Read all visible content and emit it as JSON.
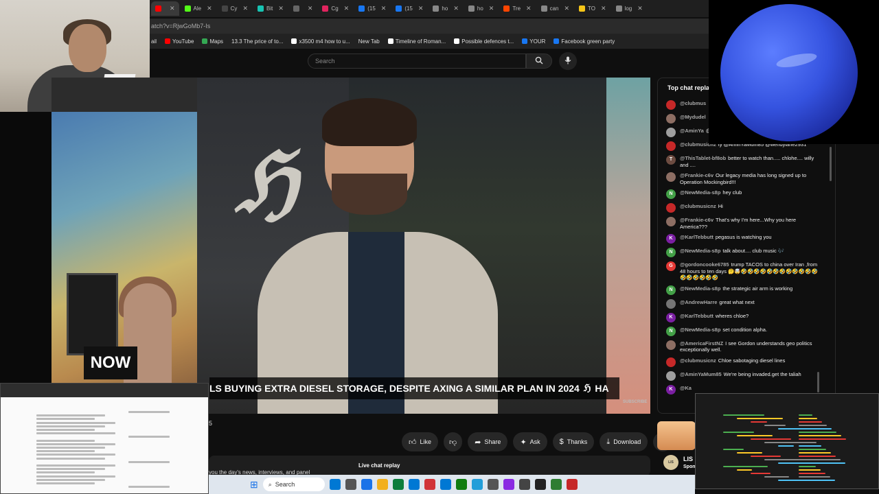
{
  "browser": {
    "tabs": [
      {
        "label": "",
        "color": "#ff0000",
        "active": true
      },
      {
        "label": "Ale",
        "color": "#53fc18"
      },
      {
        "label": "Cy",
        "color": "#444444"
      },
      {
        "label": "Bit",
        "color": "#17c3b2"
      },
      {
        "label": "",
        "color": "#666666"
      },
      {
        "label": "Cg",
        "color": "#e0245e"
      },
      {
        "label": "(15",
        "color": "#1877f2"
      },
      {
        "label": "(15",
        "color": "#1877f2"
      },
      {
        "label": "ho",
        "color": "#888888"
      },
      {
        "label": "ho",
        "color": "#888888"
      },
      {
        "label": "Tre",
        "color": "#ff4500"
      },
      {
        "label": "can",
        "color": "#888888"
      },
      {
        "label": "TO",
        "color": "#f5c518"
      },
      {
        "label": "log",
        "color": "#888888"
      }
    ],
    "address": "atch?v=RjwGoMb7-Is",
    "bookmarks": [
      {
        "label": "ail",
        "color": ""
      },
      {
        "label": "YouTube",
        "color": "#ff0000"
      },
      {
        "label": "Maps",
        "color": "#34a853"
      },
      {
        "label": "13.3 The price of to...",
        "color": ""
      },
      {
        "label": "x3500 m4 how to u...",
        "color": "#ffffff"
      },
      {
        "label": "New Tab",
        "color": ""
      },
      {
        "label": "Timeline of Roman...",
        "color": "#ffffff"
      },
      {
        "label": "Possible defences t...",
        "color": "#ffffff"
      },
      {
        "label": "YOUR",
        "color": "#1877f2"
      },
      {
        "label": "Facebook green party",
        "color": "#1877f2"
      }
    ]
  },
  "youtube": {
    "search_placeholder": "Search",
    "search_icon": "search-icon",
    "mic_icon": "mic-icon"
  },
  "video": {
    "badge": "NOW",
    "ticker": "LS BUYING EXTRA DIESEL STORAGE, DESPITE AXING A SIMILAR PLAN IN 2024",
    "ticker_logo": "ℌ",
    "ticker_tail": "HA",
    "subscribe": "SUBSCRIBE",
    "channel_logo": "ℌ"
  },
  "actions": {
    "like": "Like",
    "share": "Share",
    "ask": "Ask",
    "thanks": "Thanks",
    "download": "Download",
    "more": "⋯"
  },
  "description": {
    "text": "you the day's news, interviews, and panel",
    "live_replay": "Live chat replay",
    "count": "5"
  },
  "chat": {
    "title": "Top chat repla",
    "messages": [
      {
        "author": "@clubmus",
        "text": "",
        "initial": "",
        "color": "#c62828"
      },
      {
        "author": "@Mydudel",
        "text": "",
        "initial": "",
        "color": "#8d6e63"
      },
      {
        "author": "@AminYa",
        "text": "@gordy",
        "initial": "",
        "color": "#9e9e9e"
      },
      {
        "author": "@clubmusicnz",
        "text": "ty @AminYaMum85 @wendylane2931",
        "initial": "",
        "color": "#c62828"
      },
      {
        "author": "@ThisTablet-bf8ob",
        "text": "better to watch than..... chlohe.... willy and ....",
        "initial": "T",
        "color": "#6d4c41"
      },
      {
        "author": "@Frankie-c6v",
        "text": "Our legacy media has long signed up to Operation Mockingbird!!!",
        "initial": "",
        "color": "#8d6e63"
      },
      {
        "author": "@NewMedia-s8p",
        "text": "hey club",
        "initial": "N",
        "color": "#43a047"
      },
      {
        "author": "@clubmusicnz",
        "text": "Hi",
        "initial": "",
        "color": "#c62828"
      },
      {
        "author": "@Frankie-c6v",
        "text": "That's why I'm here...Why you here America???",
        "initial": "",
        "color": "#8d6e63"
      },
      {
        "author": "@KarlTebbutt",
        "text": "pegasus is watching you",
        "initial": "K",
        "color": "#7b1fa2"
      },
      {
        "author": "@NewMedia-s8p",
        "text": "talk about.... club music 🎶",
        "initial": "N",
        "color": "#43a047"
      },
      {
        "author": "@gordoncooke6785",
        "text": "trump TACOS to china over Iran ,from 48 hours to ten days 🤔🤯🤣🤣🤣🤣🤣🤣🤣🤣🤣🤣🤣🤣🤣🤣🤣🤣🤣🤣",
        "initial": "G",
        "color": "#e53935"
      },
      {
        "author": "@NewMedia-s8p",
        "text": "the strategic air arm is working",
        "initial": "N",
        "color": "#43a047"
      },
      {
        "author": "@AndrewHarre",
        "text": "great what next",
        "initial": "",
        "color": "#757575"
      },
      {
        "author": "@KarlTebbutt",
        "text": "wheres chloe?",
        "initial": "K",
        "color": "#7b1fa2"
      },
      {
        "author": "@NewMedia-s8p",
        "text": "set condition alpha.",
        "initial": "N",
        "color": "#43a047"
      },
      {
        "author": "@AmericaFirstNZ",
        "text": "I see Gordon understands geo politics exceptionally well.",
        "initial": "",
        "color": "#8d6e63"
      },
      {
        "author": "@clubmusicnz",
        "text": "Chloe sabotaging diesel lines",
        "initial": "",
        "color": "#c62828"
      },
      {
        "author": "@AminYaMum85",
        "text": "We're being invaded.get the taliah",
        "initial": "",
        "color": "#9e9e9e"
      },
      {
        "author": "@Ka",
        "text": "",
        "initial": "K",
        "color": "#7b1fa2"
      }
    ]
  },
  "ad": {
    "title": "LIS",
    "sub": "Spon",
    "logo": "LIS"
  },
  "taskbar": {
    "search": "Search",
    "icons": [
      "start-icon",
      "search-icon",
      "widgets-icon",
      "file-explorer-icon",
      "chrome-icon",
      "copilot-icon",
      "folder-icon",
      "edge-icon",
      "outlook-icon",
      "store-icon",
      "xbox-icon",
      "telegram-icon",
      "media-icon",
      "settings-icon",
      "obs-icon",
      "vpn-icon",
      "remote-icon",
      "mail-icon"
    ]
  }
}
